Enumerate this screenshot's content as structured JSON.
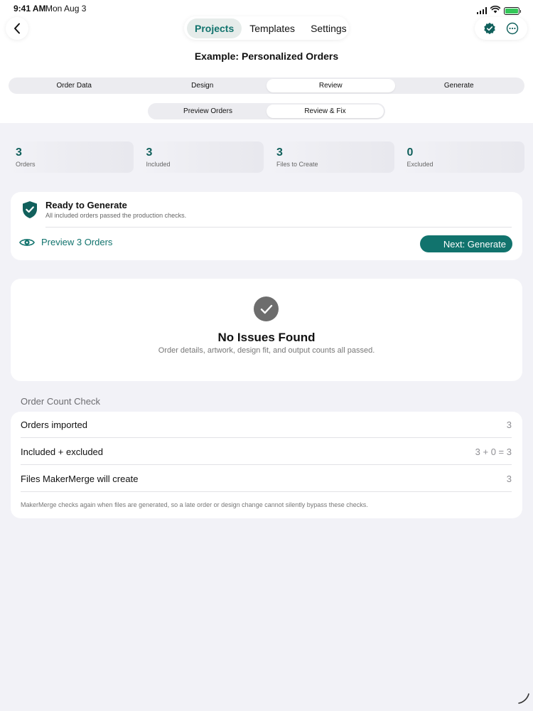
{
  "status": {
    "time": "9:41 AM",
    "date": "Mon Aug 3"
  },
  "nav": {
    "tabs": [
      "Projects",
      "Templates",
      "Settings"
    ]
  },
  "project": {
    "title": "Example: Personalized Orders"
  },
  "steps": [
    "Order Data",
    "Design",
    "Review",
    "Generate"
  ],
  "subtabs": [
    "Preview Orders",
    "Review & Fix"
  ],
  "stats": [
    {
      "value": "3",
      "label": "Orders"
    },
    {
      "value": "3",
      "label": "Included"
    },
    {
      "value": "3",
      "label": "Files to Create"
    },
    {
      "value": "0",
      "label": "Excluded"
    }
  ],
  "ready": {
    "title": "Ready to Generate",
    "subtitle": "All included orders passed the production checks.",
    "preview_label": "Preview 3 Orders",
    "next_label": "Next: Generate"
  },
  "issues": {
    "title": "No Issues Found",
    "subtitle": "Order details, artwork, design fit, and output counts all passed."
  },
  "order_count_check": {
    "header": "Order Count Check",
    "rows": [
      {
        "label": "Orders imported",
        "value": "3"
      },
      {
        "label": "Included + excluded",
        "value": "3 + 0 = 3"
      },
      {
        "label": "Files MakerMerge will create",
        "value": "3"
      }
    ],
    "footnote": "MakerMerge checks again when files are generated, so a late order or design change cannot silently bypass these checks."
  },
  "colors": {
    "accent": "#11736d",
    "stat_value": "#11605c",
    "background": "#f2f2f7",
    "card": "#ffffff"
  },
  "icons": [
    "back-chevron-icon",
    "verified-badge-icon",
    "more-icon",
    "shield-check-icon",
    "eye-icon",
    "checkmark-icon",
    "signal-icon",
    "wifi-icon",
    "battery-icon"
  ]
}
